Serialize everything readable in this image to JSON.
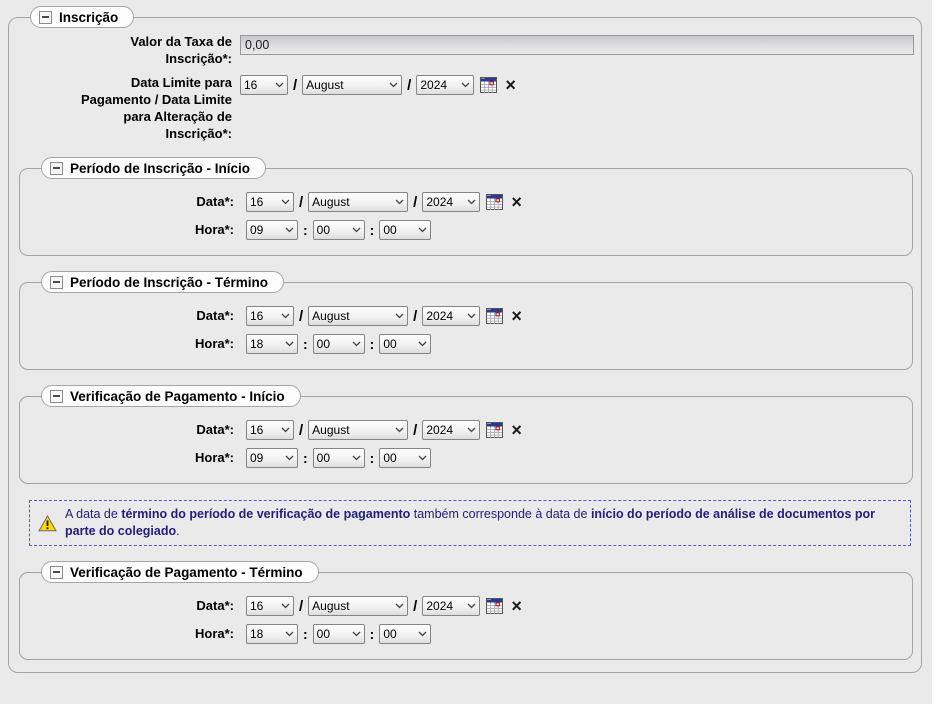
{
  "page": {
    "background": "#eaeaea",
    "right_gutter_color": "#ffffff"
  },
  "colors": {
    "fieldset_border": "#a5a5a5",
    "legend_bg": "#fdfdfd",
    "input_disabled_top": "#c7c7cb",
    "input_disabled_bottom": "#e9e9ea",
    "select_border": "#858585",
    "warning_border": "#5a5ac8",
    "warning_text": "#21217c",
    "warning_yellow": "#ffd800",
    "calendar_header_blue": "#2b3a8e",
    "calendar_red_cell": "#bb1111"
  },
  "icons": {
    "collapse": "minus-box",
    "chevron": "chevron-down",
    "calendar": "calendar-grid",
    "clear": "×",
    "warning": "warning-triangle",
    "warning_mark": "!"
  },
  "separators": {
    "date": "/",
    "time": ":"
  },
  "field_labels": {
    "date": "Data*:",
    "time": "Hora*:"
  },
  "main_section": {
    "legend": "Inscrição",
    "fee_field": {
      "label_lines": [
        "Valor da Taxa de",
        "Inscrição*:"
      ],
      "value": "0,00"
    },
    "deadline_field": {
      "label_lines": [
        "Data Limite para",
        "Pagamento / Data Limite",
        "para Alteração de",
        "Inscrição*:"
      ],
      "day": "16",
      "month": "August",
      "year": "2024"
    }
  },
  "sections": [
    {
      "legend": "Período de Inscrição - Início",
      "date": {
        "day": "16",
        "month": "August",
        "year": "2024"
      },
      "time": {
        "hour": "09",
        "minute": "00",
        "second": "00"
      }
    },
    {
      "legend": "Período de Inscrição - Término",
      "date": {
        "day": "16",
        "month": "August",
        "year": "2024"
      },
      "time": {
        "hour": "18",
        "minute": "00",
        "second": "00"
      }
    },
    {
      "legend": "Verificação de Pagamento - Início",
      "date": {
        "day": "16",
        "month": "August",
        "year": "2024"
      },
      "time": {
        "hour": "09",
        "minute": "00",
        "second": "00"
      }
    },
    {
      "legend": "Verificação de Pagamento - Término",
      "date": {
        "day": "16",
        "month": "August",
        "year": "2024"
      },
      "time": {
        "hour": "18",
        "minute": "00",
        "second": "00"
      }
    }
  ],
  "warning": {
    "segments": [
      {
        "text": "A data de ",
        "bold": false
      },
      {
        "text": "término do período de verificação de pagamento",
        "bold": true
      },
      {
        "text": " também corresponde à data de ",
        "bold": false
      },
      {
        "text": "início do período de análise de documentos por parte do colegiado",
        "bold": true
      },
      {
        "text": ".",
        "bold": false
      }
    ]
  }
}
